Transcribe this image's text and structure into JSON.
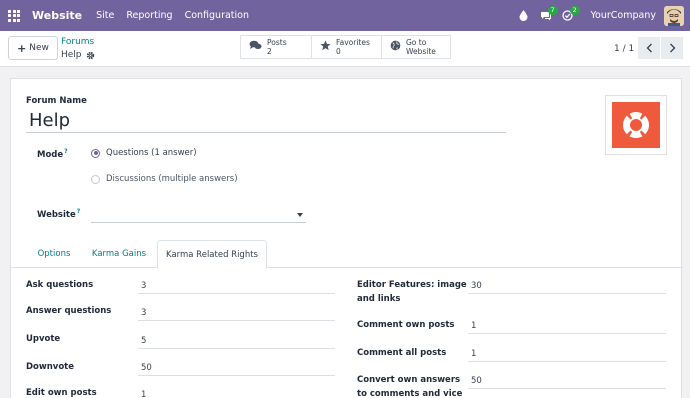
{
  "navbar": {
    "brand": "Website",
    "menu": [
      "Site",
      "Reporting",
      "Configuration"
    ],
    "chat_badge": "7",
    "activity_badge": "2",
    "company": "YourCompany"
  },
  "control_panel": {
    "new_label": "New",
    "breadcrumb_parent": "Forums",
    "breadcrumb_current": "Help",
    "stats": [
      {
        "label": "Posts",
        "value": "2",
        "icon": "comments-icon"
      },
      {
        "label": "Favorites",
        "value": "0",
        "icon": "star-icon"
      },
      {
        "label": "Go to",
        "value": "Website",
        "icon": "globe-icon"
      }
    ],
    "pager": "1 / 1"
  },
  "form": {
    "forum_name_label": "Forum Name",
    "forum_name_value": "Help",
    "mode_label": "Mode",
    "mode_help": "?",
    "mode_options": [
      {
        "label": "Questions (1 answer)",
        "selected": true
      },
      {
        "label": "Discussions (multiple answers)",
        "selected": false
      }
    ],
    "website_label": "Website",
    "website_help": "?",
    "website_value": ""
  },
  "tabs": [
    {
      "label": "Options",
      "active": false
    },
    {
      "label": "Karma Gains",
      "active": false
    },
    {
      "label": "Karma Related Rights",
      "active": true
    }
  ],
  "karma_left": [
    {
      "label": "Ask questions",
      "value": "3"
    },
    {
      "label": "Answer questions",
      "value": "3"
    },
    {
      "label": "Upvote",
      "value": "5"
    },
    {
      "label": "Downvote",
      "value": "50"
    },
    {
      "label": "Edit own posts",
      "value": "1"
    }
  ],
  "karma_right": [
    {
      "label_line1": "Editor Features: image",
      "label_line2": "and links",
      "value": "30"
    },
    {
      "label_line1": "Comment own posts",
      "label_line2": "",
      "value": "1"
    },
    {
      "label_line1": "Comment all posts",
      "label_line2": "",
      "value": "1"
    },
    {
      "label_line1": "Convert own answers",
      "label_line2": "to comments and vice",
      "value": "50"
    }
  ],
  "colors": {
    "navbar": "#71639e",
    "link": "#017e84",
    "badge": "#28a745",
    "logo_bg": "#f05a3c"
  }
}
